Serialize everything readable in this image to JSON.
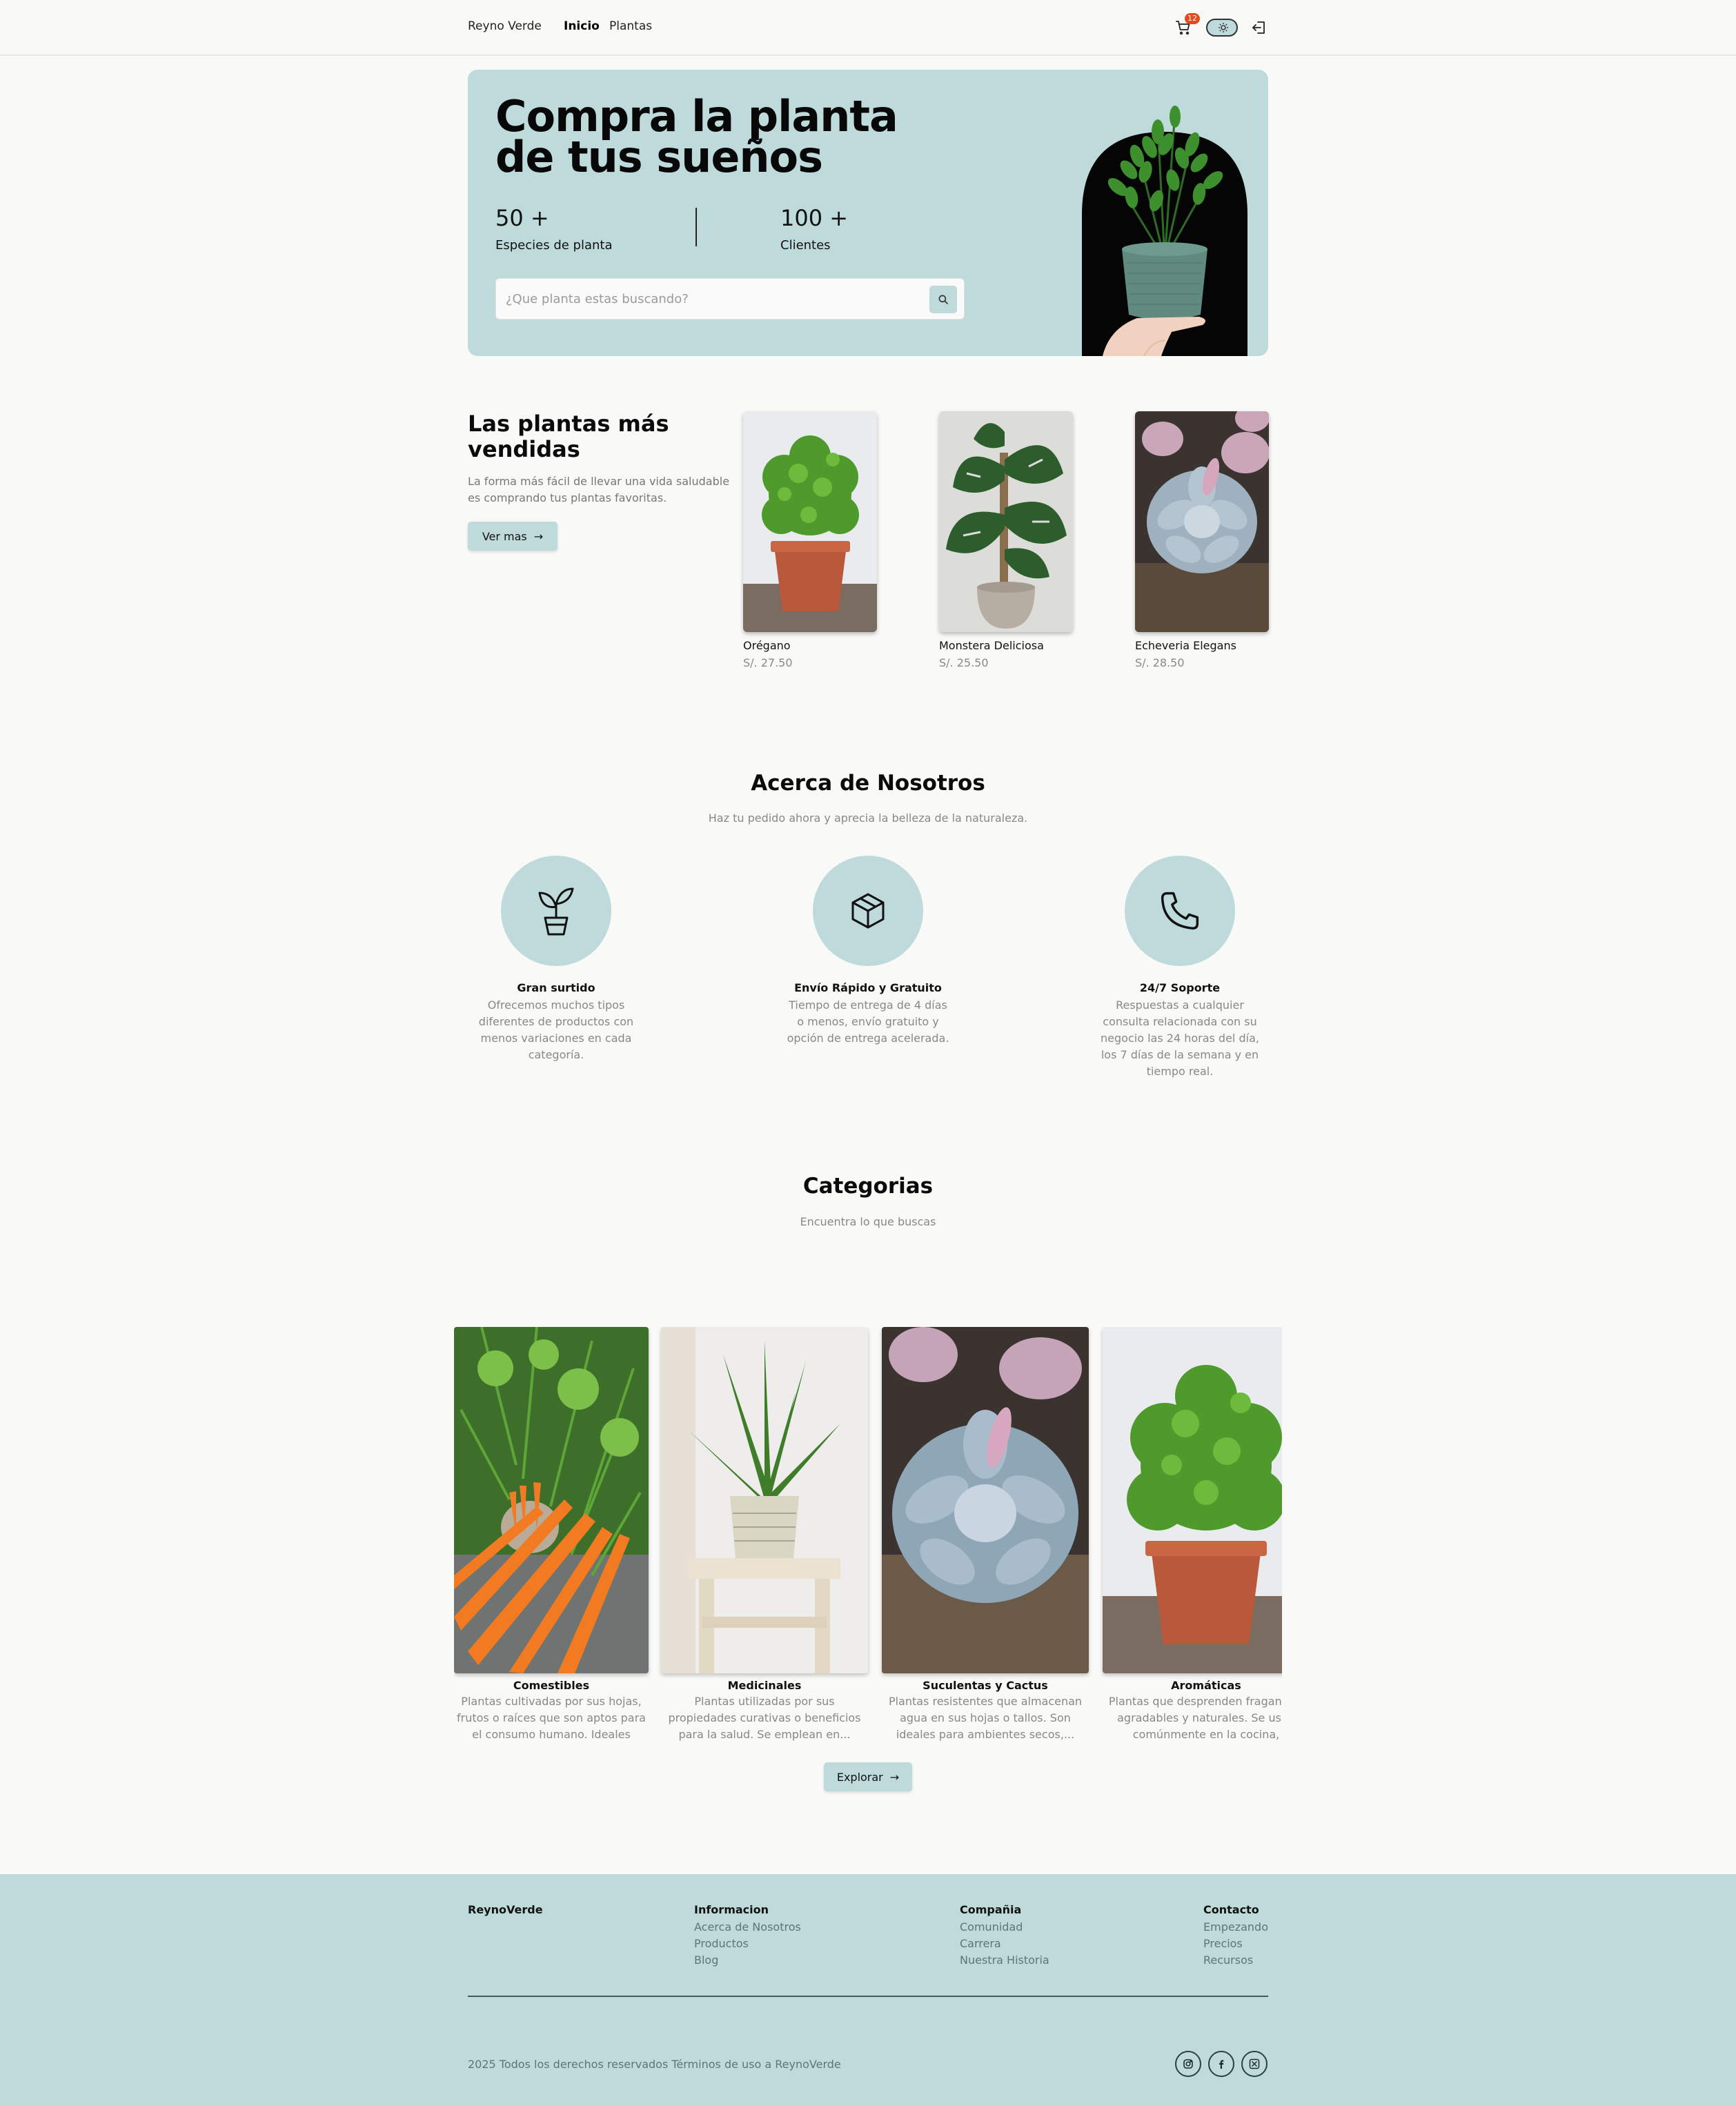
{
  "nav": {
    "brand": "Reyno Verde",
    "links": [
      {
        "label": "Inicio",
        "active": true
      },
      {
        "label": "Plantas",
        "active": false
      }
    ],
    "cart_count": "12",
    "icons": [
      "cart-icon",
      "theme-toggle",
      "logout-icon"
    ]
  },
  "hero": {
    "title": "Compra la planta de tus sueños",
    "stats": [
      {
        "value": "50 +",
        "label": "Especies de planta"
      },
      {
        "value": "100 +",
        "label": "Clientes"
      }
    ],
    "search_placeholder": "¿Que planta estas buscando?"
  },
  "best_sellers": {
    "title": "Las plantas más vendidas",
    "description": "La forma más fácil de llevar una vida saludable es comprando tus plantas favoritas.",
    "button_label": "Ver mas",
    "products": [
      {
        "name": "Orégano",
        "price": "S/. 27.50"
      },
      {
        "name": "Monstera Deliciosa",
        "price": "S/. 25.50"
      },
      {
        "name": "Echeveria Elegans",
        "price": "S/. 28.50"
      }
    ]
  },
  "about": {
    "title": "Acerca de Nosotros",
    "subtitle": "Haz tu pedido ahora y aprecia la belleza de la naturaleza.",
    "features": [
      {
        "icon": "plant-pot-icon",
        "title": "Gran surtido",
        "description": "Ofrecemos muchos tipos diferentes de productos con menos variaciones en cada categoría."
      },
      {
        "icon": "package-icon",
        "title": "Envío Rápido y Gratuito",
        "description": "Tiempo de entrega de 4 días o menos, envío gratuito y opción de entrega acelerada."
      },
      {
        "icon": "phone-icon",
        "title": "24/7 Soporte",
        "description": "Respuestas a cualquier consulta relacionada con su negocio las 24 horas del día, los 7 días de la semana y en tiempo real."
      }
    ]
  },
  "categories": {
    "title": "Categorias",
    "subtitle": "Encuentra lo que buscas",
    "items": [
      {
        "title": "Comestibles",
        "description": "Plantas cultivadas por sus hojas, frutos o raíces que son aptos para el consumo humano. Ideales para..."
      },
      {
        "title": "Medicinales",
        "description": "Plantas utilizadas por sus propiedades curativas o beneficios para la salud. Se emplean en..."
      },
      {
        "title": "Suculentas y Cactus",
        "description": "Plantas resistentes que almacenan agua en sus hojas o tallos. Son ideales para ambientes secos,..."
      },
      {
        "title": "Aromáticas",
        "description": "Plantas que desprenden fragancias agradables y naturales. Se usan comúnmente en la cocina, infusiones..."
      }
    ],
    "button_label": "Explorar"
  },
  "footer": {
    "brand": "ReynoVerde",
    "columns": [
      {
        "heading": "Informacion",
        "links": [
          "Acerca de Nosotros",
          "Productos",
          "Blog"
        ]
      },
      {
        "heading": "Compañia",
        "links": [
          "Comunidad",
          "Carrera",
          "Nuestra Historia"
        ]
      },
      {
        "heading": "Contacto",
        "links": [
          "Empezando",
          "Precios",
          "Recursos"
        ]
      }
    ],
    "copyright": "2025 Todos los derechos reservados Términos de uso a ReynoVerde",
    "social": [
      "instagram-icon",
      "facebook-icon",
      "x-twitter-icon"
    ]
  },
  "colors": {
    "accent": "#bfdadb",
    "background": "#f9f9f7",
    "badge": "#e34b1e"
  }
}
